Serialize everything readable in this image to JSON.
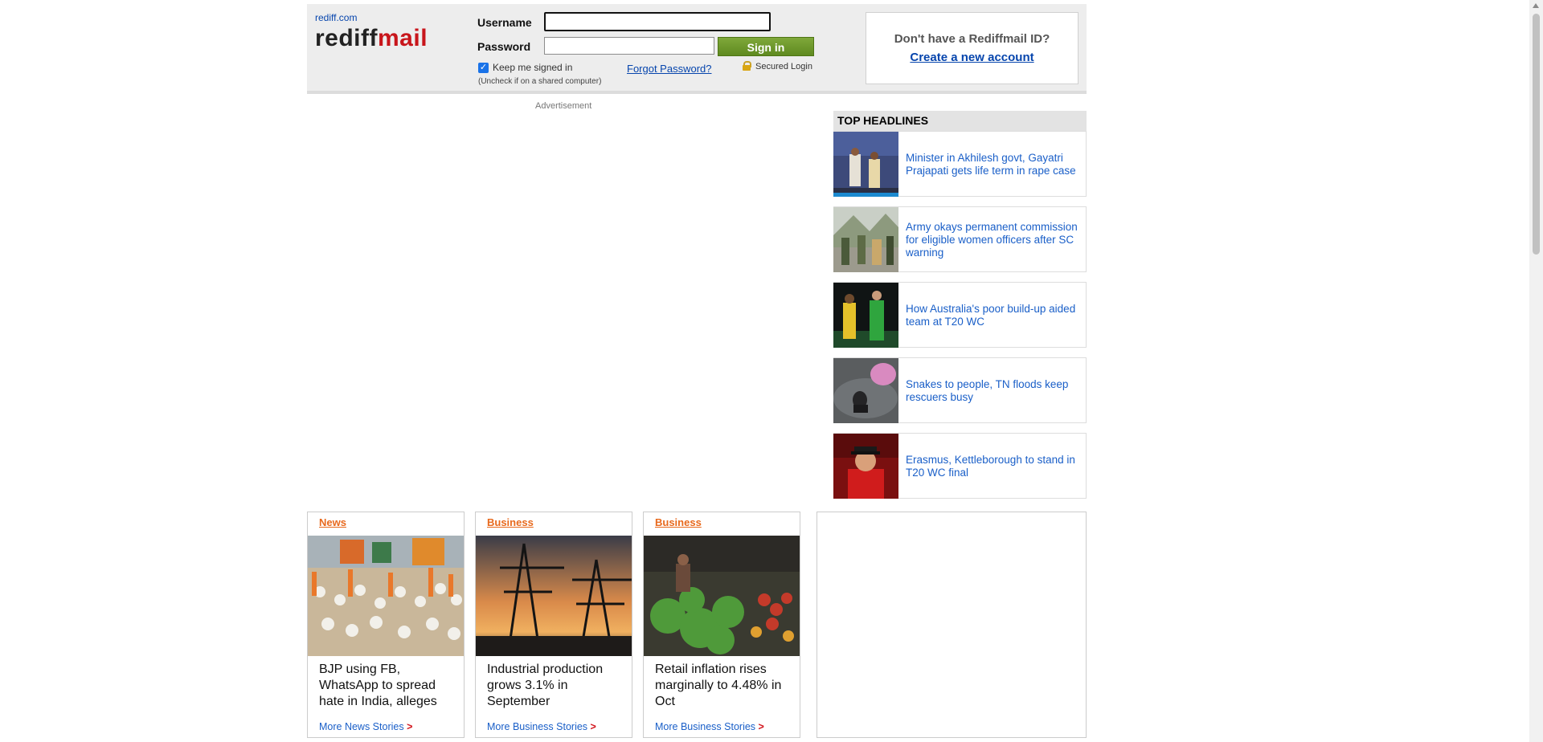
{
  "header": {
    "site_small": "rediff.com",
    "logo_part1": "rediff",
    "logo_part2": "mail",
    "username_label": "Username",
    "password_label": "Password",
    "username_value": "",
    "password_value": "",
    "signin_label": "Sign in",
    "keep_signed_in": "Keep me signed in",
    "keep_checked": true,
    "uncheck_note": "(Uncheck if on a shared computer)",
    "forgot_password": "Forgot Password?",
    "secured_login": "Secured Login",
    "signup_question": "Don't have a Rediffmail ID?",
    "create_account": "Create a new account"
  },
  "advertisement_label": "Advertisement",
  "top_headlines": {
    "title": "TOP HEADLINES",
    "items": [
      {
        "text": "Minister in Akhilesh govt, Gayatri Prajapati gets life term in rape case"
      },
      {
        "text": "Army okays permanent commission for eligible women officers after SC warning"
      },
      {
        "text": "How Australia's poor build-up aided team at T20 WC"
      },
      {
        "text": "Snakes to people, TN floods keep rescuers busy"
      },
      {
        "text": "Erasmus, Kettleborough to stand in T20 WC final"
      }
    ]
  },
  "stories": [
    {
      "category": "News",
      "title": "BJP using FB, WhatsApp to spread hate in India, alleges",
      "more": "More News Stories",
      "arrow": ">"
    },
    {
      "category": "Business",
      "title": "Industrial production grows 3.1% in September",
      "more": "More Business Stories",
      "arrow": ">"
    },
    {
      "category": "Business",
      "title": "Retail inflation rises marginally to 4.48% in Oct",
      "more": "More Business Stories",
      "arrow": ">"
    }
  ]
}
